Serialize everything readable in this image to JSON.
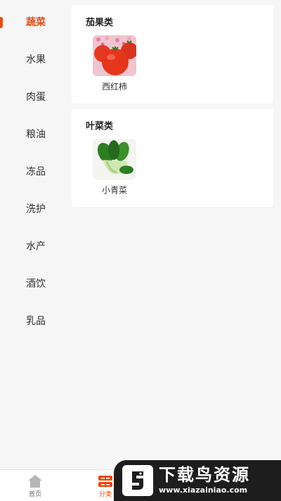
{
  "sidebar": {
    "items": [
      {
        "label": "蔬菜",
        "active": true
      },
      {
        "label": "水果"
      },
      {
        "label": "肉蛋"
      },
      {
        "label": "粮油"
      },
      {
        "label": "冻品"
      },
      {
        "label": "洗护"
      },
      {
        "label": "水产"
      },
      {
        "label": "酒饮"
      },
      {
        "label": "乳品"
      }
    ]
  },
  "sections": [
    {
      "title": "茄果类",
      "products": [
        {
          "name": "西红柿",
          "icon": "tomato-image"
        }
      ]
    },
    {
      "title": "叶菜类",
      "products": [
        {
          "name": "小青菜",
          "icon": "bok-choy-image"
        }
      ]
    }
  ],
  "tabbar": {
    "tabs": [
      {
        "label": "首页",
        "icon": "home-icon"
      },
      {
        "label": "分类",
        "icon": "category-icon",
        "active": true
      }
    ]
  },
  "watermark": {
    "title": "下载鸟资源",
    "url": "www.xiazainiao.com"
  },
  "colors": {
    "accent": "#e84a12",
    "background": "#f6f6f6"
  }
}
